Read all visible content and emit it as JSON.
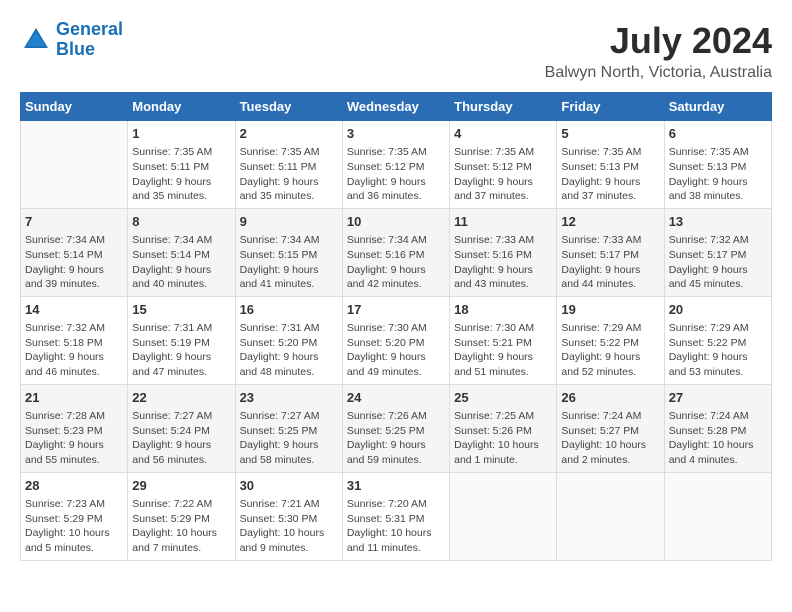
{
  "logo": {
    "line1": "General",
    "line2": "Blue"
  },
  "title": "July 2024",
  "subtitle": "Balwyn North, Victoria, Australia",
  "days_header": [
    "Sunday",
    "Monday",
    "Tuesday",
    "Wednesday",
    "Thursday",
    "Friday",
    "Saturday"
  ],
  "weeks": [
    [
      {
        "day": "",
        "content": ""
      },
      {
        "day": "1",
        "content": "Sunrise: 7:35 AM\nSunset: 5:11 PM\nDaylight: 9 hours\nand 35 minutes."
      },
      {
        "day": "2",
        "content": "Sunrise: 7:35 AM\nSunset: 5:11 PM\nDaylight: 9 hours\nand 35 minutes."
      },
      {
        "day": "3",
        "content": "Sunrise: 7:35 AM\nSunset: 5:12 PM\nDaylight: 9 hours\nand 36 minutes."
      },
      {
        "day": "4",
        "content": "Sunrise: 7:35 AM\nSunset: 5:12 PM\nDaylight: 9 hours\nand 37 minutes."
      },
      {
        "day": "5",
        "content": "Sunrise: 7:35 AM\nSunset: 5:13 PM\nDaylight: 9 hours\nand 37 minutes."
      },
      {
        "day": "6",
        "content": "Sunrise: 7:35 AM\nSunset: 5:13 PM\nDaylight: 9 hours\nand 38 minutes."
      }
    ],
    [
      {
        "day": "7",
        "content": "Sunrise: 7:34 AM\nSunset: 5:14 PM\nDaylight: 9 hours\nand 39 minutes."
      },
      {
        "day": "8",
        "content": "Sunrise: 7:34 AM\nSunset: 5:14 PM\nDaylight: 9 hours\nand 40 minutes."
      },
      {
        "day": "9",
        "content": "Sunrise: 7:34 AM\nSunset: 5:15 PM\nDaylight: 9 hours\nand 41 minutes."
      },
      {
        "day": "10",
        "content": "Sunrise: 7:34 AM\nSunset: 5:16 PM\nDaylight: 9 hours\nand 42 minutes."
      },
      {
        "day": "11",
        "content": "Sunrise: 7:33 AM\nSunset: 5:16 PM\nDaylight: 9 hours\nand 43 minutes."
      },
      {
        "day": "12",
        "content": "Sunrise: 7:33 AM\nSunset: 5:17 PM\nDaylight: 9 hours\nand 44 minutes."
      },
      {
        "day": "13",
        "content": "Sunrise: 7:32 AM\nSunset: 5:17 PM\nDaylight: 9 hours\nand 45 minutes."
      }
    ],
    [
      {
        "day": "14",
        "content": "Sunrise: 7:32 AM\nSunset: 5:18 PM\nDaylight: 9 hours\nand 46 minutes."
      },
      {
        "day": "15",
        "content": "Sunrise: 7:31 AM\nSunset: 5:19 PM\nDaylight: 9 hours\nand 47 minutes."
      },
      {
        "day": "16",
        "content": "Sunrise: 7:31 AM\nSunset: 5:20 PM\nDaylight: 9 hours\nand 48 minutes."
      },
      {
        "day": "17",
        "content": "Sunrise: 7:30 AM\nSunset: 5:20 PM\nDaylight: 9 hours\nand 49 minutes."
      },
      {
        "day": "18",
        "content": "Sunrise: 7:30 AM\nSunset: 5:21 PM\nDaylight: 9 hours\nand 51 minutes."
      },
      {
        "day": "19",
        "content": "Sunrise: 7:29 AM\nSunset: 5:22 PM\nDaylight: 9 hours\nand 52 minutes."
      },
      {
        "day": "20",
        "content": "Sunrise: 7:29 AM\nSunset: 5:22 PM\nDaylight: 9 hours\nand 53 minutes."
      }
    ],
    [
      {
        "day": "21",
        "content": "Sunrise: 7:28 AM\nSunset: 5:23 PM\nDaylight: 9 hours\nand 55 minutes."
      },
      {
        "day": "22",
        "content": "Sunrise: 7:27 AM\nSunset: 5:24 PM\nDaylight: 9 hours\nand 56 minutes."
      },
      {
        "day": "23",
        "content": "Sunrise: 7:27 AM\nSunset: 5:25 PM\nDaylight: 9 hours\nand 58 minutes."
      },
      {
        "day": "24",
        "content": "Sunrise: 7:26 AM\nSunset: 5:25 PM\nDaylight: 9 hours\nand 59 minutes."
      },
      {
        "day": "25",
        "content": "Sunrise: 7:25 AM\nSunset: 5:26 PM\nDaylight: 10 hours\nand 1 minute."
      },
      {
        "day": "26",
        "content": "Sunrise: 7:24 AM\nSunset: 5:27 PM\nDaylight: 10 hours\nand 2 minutes."
      },
      {
        "day": "27",
        "content": "Sunrise: 7:24 AM\nSunset: 5:28 PM\nDaylight: 10 hours\nand 4 minutes."
      }
    ],
    [
      {
        "day": "28",
        "content": "Sunrise: 7:23 AM\nSunset: 5:29 PM\nDaylight: 10 hours\nand 5 minutes."
      },
      {
        "day": "29",
        "content": "Sunrise: 7:22 AM\nSunset: 5:29 PM\nDaylight: 10 hours\nand 7 minutes."
      },
      {
        "day": "30",
        "content": "Sunrise: 7:21 AM\nSunset: 5:30 PM\nDaylight: 10 hours\nand 9 minutes."
      },
      {
        "day": "31",
        "content": "Sunrise: 7:20 AM\nSunset: 5:31 PM\nDaylight: 10 hours\nand 11 minutes."
      },
      {
        "day": "",
        "content": ""
      },
      {
        "day": "",
        "content": ""
      },
      {
        "day": "",
        "content": ""
      }
    ]
  ]
}
